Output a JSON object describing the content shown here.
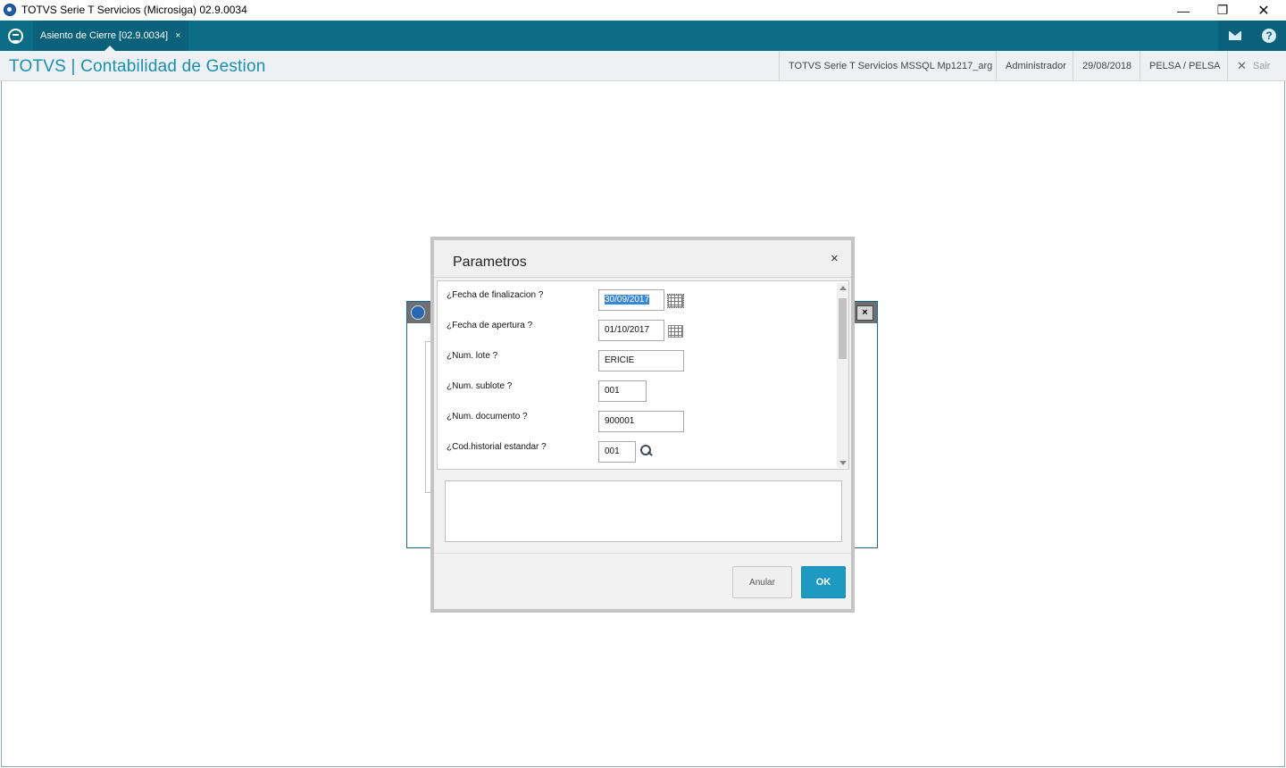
{
  "window": {
    "title": "TOTVS Serie T Servicios (Microsiga) 02.9.0034",
    "minimize_glyph": "—",
    "maximize_glyph": "❐",
    "close_glyph": "✕"
  },
  "tabbar": {
    "active_tab": "Asiento de Cierre [02.9.0034]",
    "tab_close": "×",
    "help_glyph": "?"
  },
  "header": {
    "module_title": "TOTVS | Contabilidad de Gestion",
    "environment": "TOTVS Serie T Servicios MSSQL Mp1217_arg",
    "user": "Administrador",
    "date": "29/08/2018",
    "company": "PELSA / PELSA",
    "exit_glyph": "✕",
    "exit_label": "Sair"
  },
  "background_window": {
    "close_glyph": "×"
  },
  "dialog": {
    "title": "Parametros",
    "close_glyph": "×",
    "params": [
      {
        "label": "¿Fecha de finalizacion ?",
        "value": "30/09/2017",
        "selected": true,
        "accessory": "calendar-icon"
      },
      {
        "label": "¿Fecha de apertura ?",
        "value": "01/10/2017",
        "accessory": "calendar-icon"
      },
      {
        "label": "¿Num. lote ?",
        "value": "ERICIE"
      },
      {
        "label": "¿Num. sublote ?",
        "value": "001"
      },
      {
        "label": "¿Num. documento ?",
        "value": "900001"
      },
      {
        "label": "¿Cod.historial estandar ?",
        "value": "001",
        "accessory": "search-icon"
      }
    ],
    "description": "",
    "cancel_label": "Anular",
    "ok_label": "OK"
  },
  "colors": {
    "tabbar_bg": "#0c6e86",
    "module_title": "#1a8fb0",
    "ok_button": "#1e99c2",
    "selection": "#3a86d6"
  }
}
